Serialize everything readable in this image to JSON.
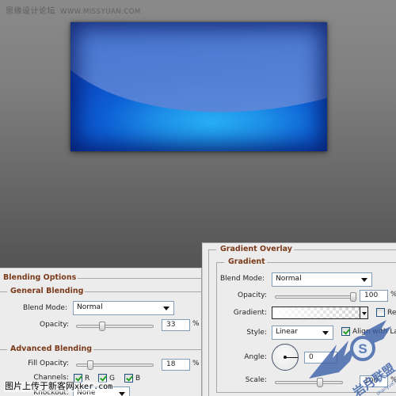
{
  "watermarks": {
    "top_cn": "思缘设计论坛",
    "top_url": "WWW.MISSYUAN.COM",
    "bottom_cn": "图片上传于新客网",
    "bottom_url": "xker.com",
    "logo_text": "shanyue.com",
    "logo_cn": "岩月联盟",
    "logo_letter": "S"
  },
  "canvas": {
    "colors": {
      "light_blue": "#27b0f5",
      "mid_blue": "#0d5fd4",
      "dark_blue": "#0a2f9a",
      "shine": "#4e7ad2"
    }
  },
  "blending_options": {
    "title": "Blending Options",
    "general": {
      "title": "General Blending",
      "blend_mode_label": "Blend Mode:",
      "blend_mode_value": "Normal",
      "opacity_label": "Opacity:",
      "opacity_value": "33",
      "opacity_fraction": 0.33,
      "pct": "%"
    },
    "advanced": {
      "title": "Advanced Blending",
      "fill_opacity_label": "Fill Opacity:",
      "fill_opacity_value": "18",
      "fill_opacity_fraction": 0.18,
      "pct": "%",
      "channels_label": "Channels:",
      "channels": [
        {
          "label": "R",
          "checked": true
        },
        {
          "label": "G",
          "checked": true
        },
        {
          "label": "B",
          "checked": true
        }
      ],
      "knockout_label": "Knockout:",
      "knockout_value": "None"
    }
  },
  "gradient_overlay": {
    "title": "Gradient Overlay",
    "group_title": "Gradient",
    "blend_mode_label": "Blend Mode:",
    "blend_mode_value": "Normal",
    "opacity_label": "Opacity:",
    "opacity_value": "100",
    "opacity_fraction": 1.0,
    "pct": "%",
    "gradient_label": "Gradient:",
    "reverse_label": "Reverse",
    "reverse_checked": false,
    "style_label": "Style:",
    "style_value": "Linear",
    "align_label": "Align with Layer",
    "align_checked": true,
    "angle_label": "Angle:",
    "angle_value": "0",
    "scale_label": "Scale:",
    "scale_value": "100",
    "scale_fraction": 0.67
  }
}
